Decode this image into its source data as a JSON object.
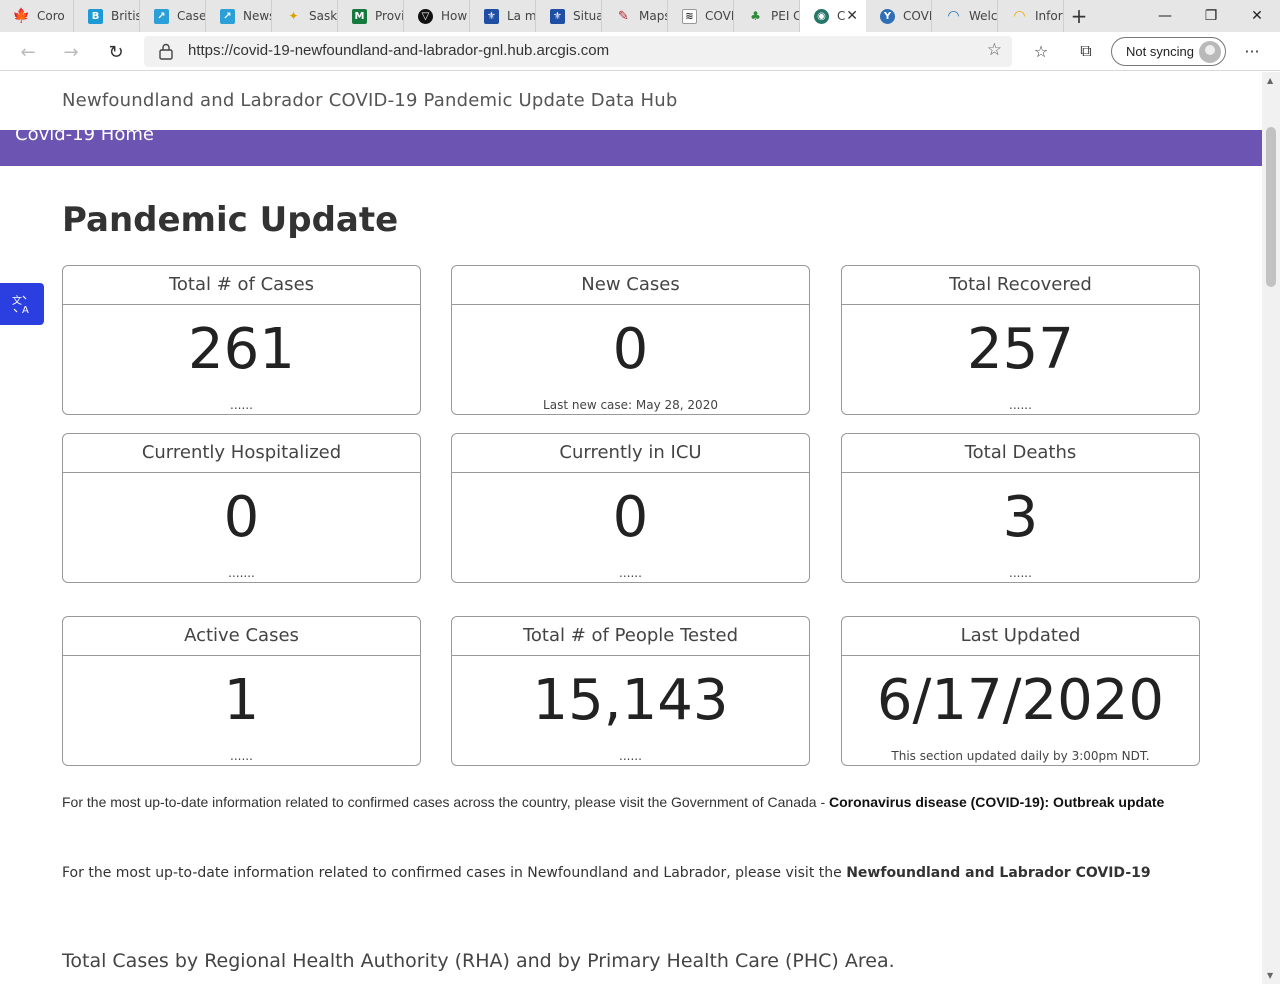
{
  "browser": {
    "tabs": [
      {
        "label": "Coro",
        "icon": "maple-leaf-icon"
      },
      {
        "label": "Britisl",
        "icon": "bc-icon"
      },
      {
        "label": "Cases",
        "icon": "dashboard-icon"
      },
      {
        "label": "News",
        "icon": "dashboard-icon"
      },
      {
        "label": "Saska",
        "icon": "wheat-icon"
      },
      {
        "label": "Provi",
        "icon": "manitoba-icon"
      },
      {
        "label": "How",
        "icon": "ontario-icon"
      },
      {
        "label": "La m",
        "icon": "quebec-icon"
      },
      {
        "label": "Situat",
        "icon": "quebec-icon"
      },
      {
        "label": "Maps",
        "icon": "nb-icon"
      },
      {
        "label": "COVI",
        "icon": "ns-icon"
      },
      {
        "label": "PEI C",
        "icon": "pei-icon"
      },
      {
        "label": "C",
        "icon": "globe-icon",
        "active": true
      },
      {
        "label": "COVI",
        "icon": "yukon-icon"
      },
      {
        "label": "Welc",
        "icon": "nwt-icon"
      },
      {
        "label": "Inforr",
        "icon": "nunavut-icon"
      }
    ],
    "url": "https://covid-19-newfoundland-and-labrador-gnl.hub.arcgis.com",
    "profile_label": "Not syncing"
  },
  "site": {
    "title": "Newfoundland and Labrador COVID-19 Pandemic Update Data Hub",
    "nav_home": "Covid-19 Home"
  },
  "page": {
    "heading": "Pandemic Update",
    "cards": [
      {
        "title": "Total # of Cases",
        "value": "261",
        "footer": "......"
      },
      {
        "title": "New Cases",
        "value": "0",
        "footer": "Last new case: May 28, 2020"
      },
      {
        "title": "Total Recovered",
        "value": "257",
        "footer": "......"
      },
      {
        "title": "Currently Hospitalized",
        "value": "0",
        "footer": "......."
      },
      {
        "title": "Currently in ICU",
        "value": "0",
        "footer": "......"
      },
      {
        "title": "Total Deaths",
        "value": "3",
        "footer": "......"
      },
      {
        "title": "Active Cases",
        "value": "1",
        "footer": "......"
      },
      {
        "title": "Total # of People Tested",
        "value": "15,143",
        "footer": "......"
      },
      {
        "title": "Last Updated",
        "value": "6/17/2020",
        "footer": "This section updated daily by 3:00pm NDT."
      }
    ],
    "info1_text": "For the most up-to-date information related to confirmed cases across the country, please visit the Government of Canada - ",
    "info1_link": "Coronavirus disease (COVID-19): Outbreak update",
    "info2_text": "For the most up-to-date information related to confirmed cases in Newfoundland and Labrador, please visit the ",
    "info2_link": "Newfoundland and Labrador COVID-19",
    "subheading": "Total Cases by Regional Health Authority (RHA) and by Primary Health Care (PHC) Area."
  },
  "colors": {
    "nav_purple": "#6b54b2",
    "translate_blue": "#2b3fe0"
  }
}
